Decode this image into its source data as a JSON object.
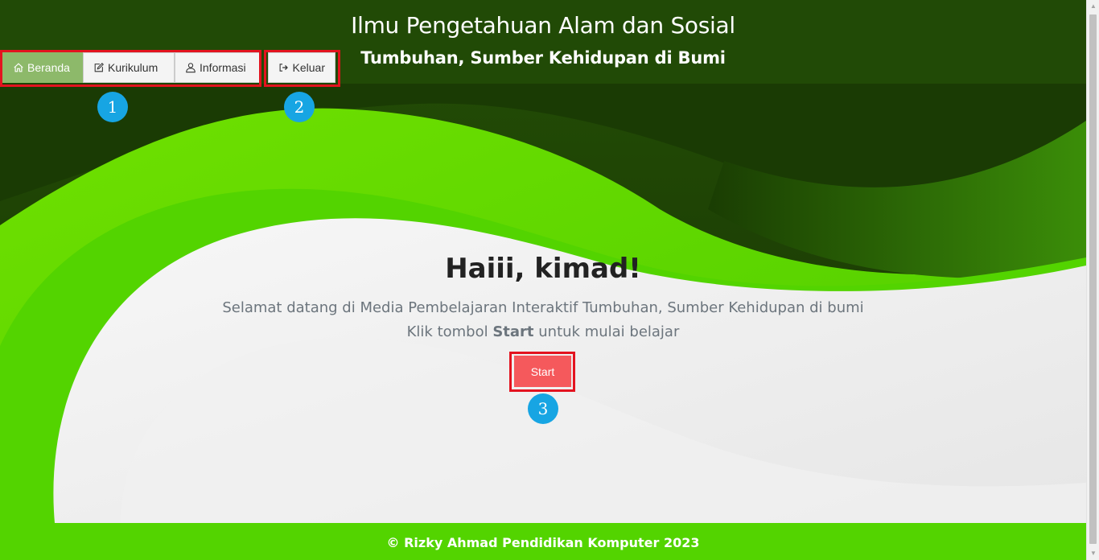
{
  "header": {
    "title": "Ilmu Pengetahuan Alam dan Sosial",
    "subtitle": "Tumbuhan, Sumber Kehidupan di Bumi"
  },
  "nav": {
    "items": [
      {
        "label": "Beranda",
        "icon": "home-icon",
        "active": true
      },
      {
        "label": "Kurikulum",
        "icon": "edit-icon",
        "active": false
      },
      {
        "label": "Informasi",
        "icon": "user-icon",
        "active": false
      }
    ],
    "logout": {
      "label": "Keluar",
      "icon": "logout-icon"
    }
  },
  "annotations": [
    "1",
    "2",
    "3"
  ],
  "hero": {
    "greeting": "Haiii, kimad!",
    "line1": "Selamat datang di Media Pembelajaran Interaktif Tumbuhan, Sumber Kehidupan di bumi",
    "line2_prefix": "Klik tombol ",
    "line2_bold": "Start",
    "line2_suffix": " untuk mulai belajar",
    "start_label": "Start"
  },
  "footer": {
    "text": "© Rizky Ahmad Pendidikan Komputer 2023"
  },
  "colors": {
    "dark_green": "#1f4a05",
    "bright_green": "#53d400",
    "active_nav": "#8db96a",
    "start_button": "#f5595c",
    "highlight": "#e3131f",
    "badge": "#17a5e3"
  }
}
